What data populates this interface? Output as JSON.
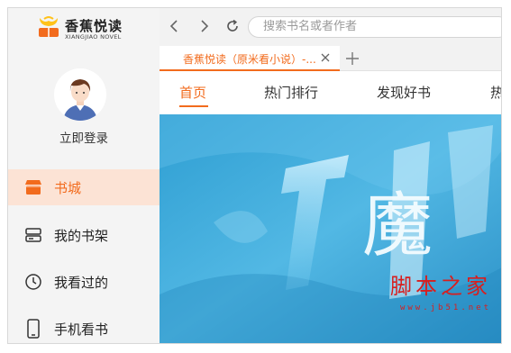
{
  "app": {
    "name": "香蕉悦读",
    "subtitle": "XIANGJIAO NOVEL"
  },
  "user": {
    "login_label": "立即登录"
  },
  "sidebar": {
    "items": [
      {
        "label": "书城",
        "icon": "store-icon",
        "active": true
      },
      {
        "label": "我的书架",
        "icon": "bookshelf-icon",
        "active": false
      },
      {
        "label": "我看过的",
        "icon": "clock-icon",
        "active": false
      },
      {
        "label": "手机看书",
        "icon": "phone-icon",
        "active": false
      }
    ]
  },
  "toolbar": {
    "back_icon": "chevron-left-icon",
    "forward_icon": "chevron-right-icon",
    "refresh_icon": "refresh-icon",
    "search_placeholder": "搜索书名或者作者"
  },
  "tabs": [
    {
      "title": "香蕉悦读（原米看小说）-...",
      "active": true
    }
  ],
  "menu": {
    "items": [
      {
        "label": "首页",
        "active": true
      },
      {
        "label": "热门排行",
        "active": false
      },
      {
        "label": "发现好书",
        "active": false
      },
      {
        "label": "热",
        "active": false
      }
    ]
  },
  "banner": {
    "headline": "魔"
  },
  "watermark": {
    "text": "脚本之家",
    "url": "www.jb51.net"
  },
  "colors": {
    "accent": "#f26b1d",
    "sidebar_bg": "#f4f4f4",
    "active_bg": "#fce3d5",
    "banner_blue": "#3aa9d8"
  }
}
